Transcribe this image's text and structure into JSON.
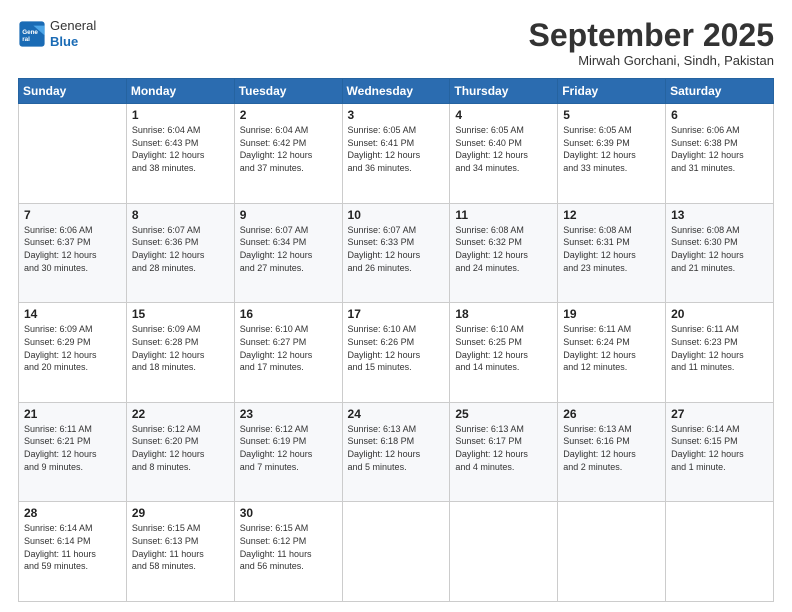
{
  "logo": {
    "line1": "General",
    "line2": "Blue"
  },
  "header": {
    "month": "September 2025",
    "location": "Mirwah Gorchani, Sindh, Pakistan"
  },
  "days_of_week": [
    "Sunday",
    "Monday",
    "Tuesday",
    "Wednesday",
    "Thursday",
    "Friday",
    "Saturday"
  ],
  "weeks": [
    [
      {
        "day": "",
        "info": ""
      },
      {
        "day": "1",
        "info": "Sunrise: 6:04 AM\nSunset: 6:43 PM\nDaylight: 12 hours\nand 38 minutes."
      },
      {
        "day": "2",
        "info": "Sunrise: 6:04 AM\nSunset: 6:42 PM\nDaylight: 12 hours\nand 37 minutes."
      },
      {
        "day": "3",
        "info": "Sunrise: 6:05 AM\nSunset: 6:41 PM\nDaylight: 12 hours\nand 36 minutes."
      },
      {
        "day": "4",
        "info": "Sunrise: 6:05 AM\nSunset: 6:40 PM\nDaylight: 12 hours\nand 34 minutes."
      },
      {
        "day": "5",
        "info": "Sunrise: 6:05 AM\nSunset: 6:39 PM\nDaylight: 12 hours\nand 33 minutes."
      },
      {
        "day": "6",
        "info": "Sunrise: 6:06 AM\nSunset: 6:38 PM\nDaylight: 12 hours\nand 31 minutes."
      }
    ],
    [
      {
        "day": "7",
        "info": "Sunrise: 6:06 AM\nSunset: 6:37 PM\nDaylight: 12 hours\nand 30 minutes."
      },
      {
        "day": "8",
        "info": "Sunrise: 6:07 AM\nSunset: 6:36 PM\nDaylight: 12 hours\nand 28 minutes."
      },
      {
        "day": "9",
        "info": "Sunrise: 6:07 AM\nSunset: 6:34 PM\nDaylight: 12 hours\nand 27 minutes."
      },
      {
        "day": "10",
        "info": "Sunrise: 6:07 AM\nSunset: 6:33 PM\nDaylight: 12 hours\nand 26 minutes."
      },
      {
        "day": "11",
        "info": "Sunrise: 6:08 AM\nSunset: 6:32 PM\nDaylight: 12 hours\nand 24 minutes."
      },
      {
        "day": "12",
        "info": "Sunrise: 6:08 AM\nSunset: 6:31 PM\nDaylight: 12 hours\nand 23 minutes."
      },
      {
        "day": "13",
        "info": "Sunrise: 6:08 AM\nSunset: 6:30 PM\nDaylight: 12 hours\nand 21 minutes."
      }
    ],
    [
      {
        "day": "14",
        "info": "Sunrise: 6:09 AM\nSunset: 6:29 PM\nDaylight: 12 hours\nand 20 minutes."
      },
      {
        "day": "15",
        "info": "Sunrise: 6:09 AM\nSunset: 6:28 PM\nDaylight: 12 hours\nand 18 minutes."
      },
      {
        "day": "16",
        "info": "Sunrise: 6:10 AM\nSunset: 6:27 PM\nDaylight: 12 hours\nand 17 minutes."
      },
      {
        "day": "17",
        "info": "Sunrise: 6:10 AM\nSunset: 6:26 PM\nDaylight: 12 hours\nand 15 minutes."
      },
      {
        "day": "18",
        "info": "Sunrise: 6:10 AM\nSunset: 6:25 PM\nDaylight: 12 hours\nand 14 minutes."
      },
      {
        "day": "19",
        "info": "Sunrise: 6:11 AM\nSunset: 6:24 PM\nDaylight: 12 hours\nand 12 minutes."
      },
      {
        "day": "20",
        "info": "Sunrise: 6:11 AM\nSunset: 6:23 PM\nDaylight: 12 hours\nand 11 minutes."
      }
    ],
    [
      {
        "day": "21",
        "info": "Sunrise: 6:11 AM\nSunset: 6:21 PM\nDaylight: 12 hours\nand 9 minutes."
      },
      {
        "day": "22",
        "info": "Sunrise: 6:12 AM\nSunset: 6:20 PM\nDaylight: 12 hours\nand 8 minutes."
      },
      {
        "day": "23",
        "info": "Sunrise: 6:12 AM\nSunset: 6:19 PM\nDaylight: 12 hours\nand 7 minutes."
      },
      {
        "day": "24",
        "info": "Sunrise: 6:13 AM\nSunset: 6:18 PM\nDaylight: 12 hours\nand 5 minutes."
      },
      {
        "day": "25",
        "info": "Sunrise: 6:13 AM\nSunset: 6:17 PM\nDaylight: 12 hours\nand 4 minutes."
      },
      {
        "day": "26",
        "info": "Sunrise: 6:13 AM\nSunset: 6:16 PM\nDaylight: 12 hours\nand 2 minutes."
      },
      {
        "day": "27",
        "info": "Sunrise: 6:14 AM\nSunset: 6:15 PM\nDaylight: 12 hours\nand 1 minute."
      }
    ],
    [
      {
        "day": "28",
        "info": "Sunrise: 6:14 AM\nSunset: 6:14 PM\nDaylight: 11 hours\nand 59 minutes."
      },
      {
        "day": "29",
        "info": "Sunrise: 6:15 AM\nSunset: 6:13 PM\nDaylight: 11 hours\nand 58 minutes."
      },
      {
        "day": "30",
        "info": "Sunrise: 6:15 AM\nSunset: 6:12 PM\nDaylight: 11 hours\nand 56 minutes."
      },
      {
        "day": "",
        "info": ""
      },
      {
        "day": "",
        "info": ""
      },
      {
        "day": "",
        "info": ""
      },
      {
        "day": "",
        "info": ""
      }
    ]
  ]
}
